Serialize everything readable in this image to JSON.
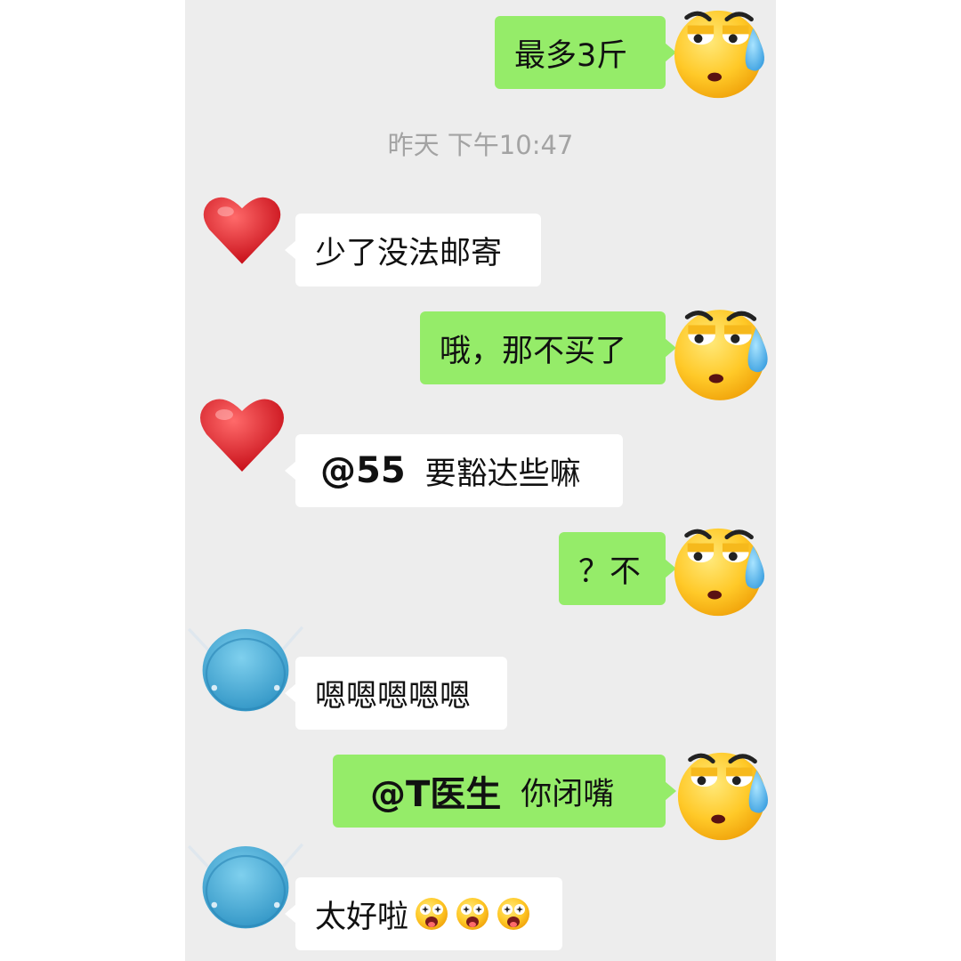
{
  "timestamp": "昨天 下午10:47",
  "messages": [
    {
      "side": "out",
      "text": "最多3斤"
    },
    {
      "side": "in",
      "sender_avatar": "heart-icon",
      "text": "少了没法邮寄"
    },
    {
      "side": "out",
      "text": "哦，那不买了"
    },
    {
      "side": "in",
      "sender_avatar": "heart-icon",
      "mention": "@55",
      "text": "要豁达些嘛"
    },
    {
      "side": "out",
      "text": "？不"
    },
    {
      "side": "in",
      "sender_avatar": "mask-icon",
      "text": "嗯嗯嗯嗯嗯"
    },
    {
      "side": "out",
      "mention": "@T医生",
      "text": "你闭嘴"
    },
    {
      "side": "in",
      "sender_avatar": "mask-icon",
      "text": "太好啦",
      "emojis": [
        "starstruck-emoji",
        "starstruck-emoji",
        "starstruck-emoji"
      ]
    }
  ],
  "colors": {
    "outgoing_bubble": "#95ec69",
    "incoming_bubble": "#ffffff",
    "background": "#ededed"
  }
}
